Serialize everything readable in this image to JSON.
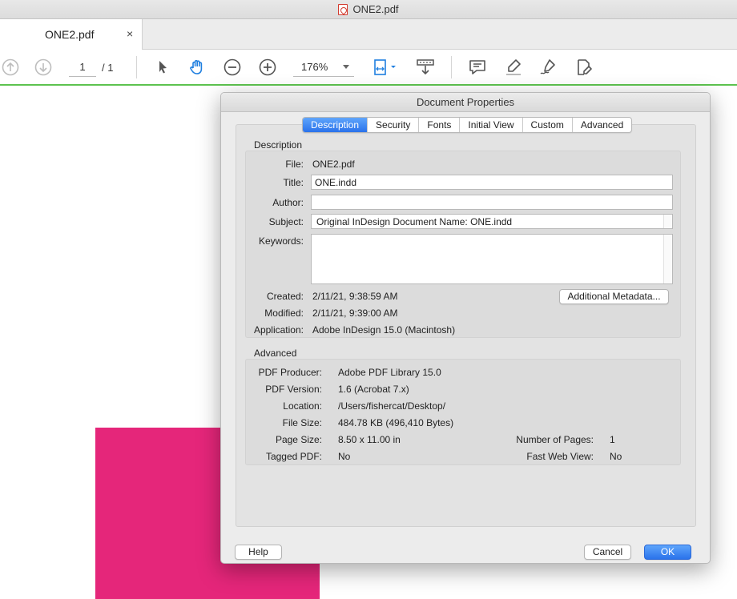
{
  "window": {
    "title": "ONE2.pdf"
  },
  "tab": {
    "label": "ONE2.pdf",
    "close": "×"
  },
  "toolbar": {
    "page_current": "1",
    "page_total": "/ 1",
    "zoom": "176%"
  },
  "dialog": {
    "title": "Document Properties",
    "tabs": [
      {
        "label": "Description",
        "active": true
      },
      {
        "label": "Security"
      },
      {
        "label": "Fonts"
      },
      {
        "label": "Initial View"
      },
      {
        "label": "Custom"
      },
      {
        "label": "Advanced"
      }
    ],
    "description": {
      "section_label": "Description",
      "file_label": "File:",
      "file_value": "ONE2.pdf",
      "title_label": "Title:",
      "title_value": "ONE.indd",
      "author_label": "Author:",
      "author_value": "",
      "subject_label": "Subject:",
      "subject_value": "Original InDesign Document Name: ONE.indd",
      "keywords_label": "Keywords:",
      "keywords_value": "",
      "created_label": "Created:",
      "created_value": "2/11/21, 9:38:59 AM",
      "modified_label": "Modified:",
      "modified_value": "2/11/21, 9:39:00 AM",
      "application_label": "Application:",
      "application_value": "Adobe InDesign 15.0 (Macintosh)",
      "metadata_button": "Additional Metadata..."
    },
    "advanced": {
      "section_label": "Advanced",
      "producer_label": "PDF Producer:",
      "producer_value": "Adobe PDF Library 15.0",
      "version_label": "PDF Version:",
      "version_value": "1.6 (Acrobat 7.x)",
      "location_label": "Location:",
      "location_value": "/Users/fishercat/Desktop/",
      "filesize_label": "File Size:",
      "filesize_value": "484.78 KB (496,410 Bytes)",
      "pagesize_label": "Page Size:",
      "pagesize_value": "8.50 x 11.00 in",
      "pages_label": "Number of Pages:",
      "pages_value": "1",
      "tagged_label": "Tagged PDF:",
      "tagged_value": "No",
      "fastweb_label": "Fast Web View:",
      "fastweb_value": "No"
    },
    "buttons": {
      "help": "Help",
      "cancel": "Cancel",
      "ok": "OK"
    }
  },
  "colors": {
    "accent": "#2a72eb",
    "pink": "#e5267a",
    "toolbar_border": "#5dc34f"
  }
}
